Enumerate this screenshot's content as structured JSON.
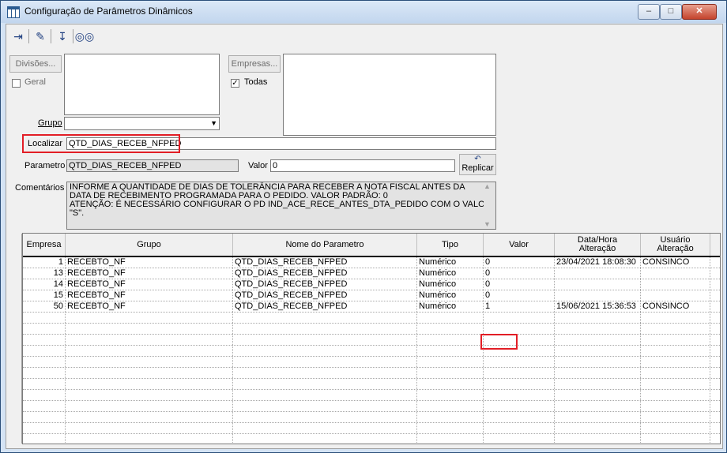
{
  "window": {
    "title": "Configuração de Parâmetros Dinâmicos"
  },
  "toolbar": {
    "icons": [
      "exit-icon",
      "pencil-icon",
      "save-down-icon",
      "binoculars-icon"
    ]
  },
  "filters": {
    "divisoes_button": "Divisões...",
    "geral_label": "Geral",
    "empresas_button": "Empresas...",
    "todas_label": "Todas",
    "grupo_label": "Grupo",
    "grupo_value": "",
    "localizar_label": "Localizar",
    "localizar_value": "QTD_DIAS_RECEB_NFPED",
    "parametro_label": "Parametro",
    "parametro_value": "QTD_DIAS_RECEB_NFPED",
    "valor_label": "Valor",
    "valor_value": "0",
    "replicar_button": "Replicar",
    "comentarios_label": "Comentários",
    "comentarios_lines": [
      "INFORME A QUANTIDADE DE DIAS DE TOLERÂNCIA PARA RECEBER A NOTA FISCAL ANTES DA",
      "DATA DE RECEBIMENTO PROGRAMADA PARA O PEDIDO. VALOR PADRÃO: 0",
      "ATENÇÃO: É NECESSÁRIO CONFIGURAR O PD IND_ACE_RECE_ANTES_DTA_PEDIDO COM O VALOR",
      "\"S\"."
    ]
  },
  "grid": {
    "headers": [
      {
        "l1": "Empresa",
        "l2": ""
      },
      {
        "l1": "Grupo",
        "l2": ""
      },
      {
        "l1": "Nome do Parametro",
        "l2": ""
      },
      {
        "l1": "Tipo",
        "l2": ""
      },
      {
        "l1": "Valor",
        "l2": ""
      },
      {
        "l1": "Data/Hora",
        "l2": "Alteração"
      },
      {
        "l1": "Usuário",
        "l2": "Alteração"
      }
    ],
    "rows": [
      [
        "1",
        "RECEBTO_NF",
        "QTD_DIAS_RECEB_NFPED",
        "Numérico",
        "0",
        "23/04/2021 18:08:30",
        "CONSINCO"
      ],
      [
        "13",
        "RECEBTO_NF",
        "QTD_DIAS_RECEB_NFPED",
        "Numérico",
        "0",
        "",
        ""
      ],
      [
        "14",
        "RECEBTO_NF",
        "QTD_DIAS_RECEB_NFPED",
        "Numérico",
        "0",
        "",
        ""
      ],
      [
        "15",
        "RECEBTO_NF",
        "QTD_DIAS_RECEB_NFPED",
        "Numérico",
        "0",
        "",
        ""
      ],
      [
        "50",
        "RECEBTO_NF",
        "QTD_DIAS_RECEB_NFPED",
        "Numérico",
        "1",
        "15/06/2021 15:36:53",
        "CONSINCO"
      ]
    ]
  }
}
